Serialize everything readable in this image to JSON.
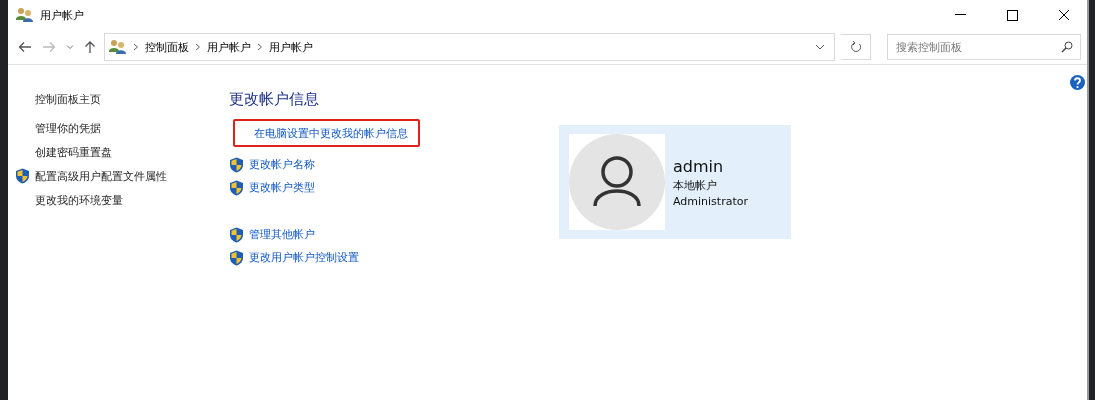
{
  "window": {
    "title": "用户帐户"
  },
  "breadcrumb": [
    "控制面板",
    "用户帐户",
    "用户帐户"
  ],
  "search": {
    "placeholder": "搜索控制面板"
  },
  "sidebar": {
    "groups": [
      [
        {
          "label": "控制面板主页",
          "shield": false
        }
      ],
      [
        {
          "label": "管理你的凭据",
          "shield": false
        },
        {
          "label": "创建密码重置盘",
          "shield": false
        },
        {
          "label": "配置高级用户配置文件属性",
          "shield": true
        },
        {
          "label": "更改我的环境变量",
          "shield": false
        }
      ]
    ]
  },
  "main": {
    "heading": "更改帐户信息",
    "groups": [
      [
        {
          "label": "在电脑设置中更改我的帐户信息",
          "shield": false,
          "highlighted": true
        }
      ],
      [
        {
          "label": "更改帐户名称",
          "shield": true,
          "highlighted": false
        },
        {
          "label": "更改帐户类型",
          "shield": true,
          "highlighted": false
        }
      ],
      [
        {
          "label": "管理其他帐户",
          "shield": true,
          "highlighted": false
        },
        {
          "label": "更改用户帐户控制设置",
          "shield": true,
          "highlighted": false
        }
      ]
    ]
  },
  "account": {
    "name": "admin",
    "type": "本地帐户",
    "role": "Administrator"
  }
}
